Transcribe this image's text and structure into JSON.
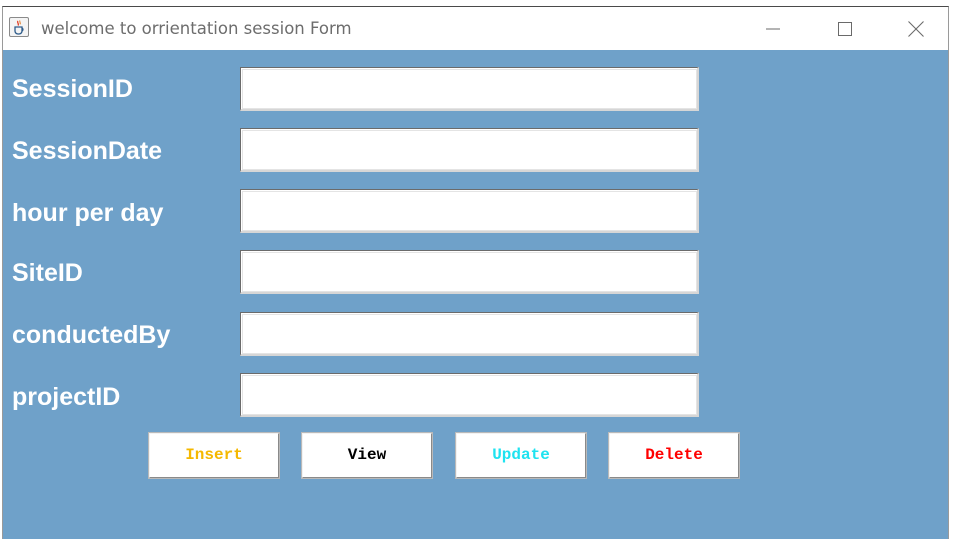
{
  "window": {
    "title": "welcome to orrientation session Form"
  },
  "form": {
    "fields": [
      {
        "label": "SessionID",
        "value": ""
      },
      {
        "label": "SessionDate",
        "value": ""
      },
      {
        "label": "hour per day",
        "value": ""
      },
      {
        "label": "SiteID",
        "value": ""
      },
      {
        "label": "conductedBy",
        "value": ""
      },
      {
        "label": "projectID",
        "value": ""
      }
    ]
  },
  "buttons": {
    "insert": {
      "label": "Insert",
      "color": "#f5b800"
    },
    "view": {
      "label": "View",
      "color": "#000000"
    },
    "update": {
      "label": "Update",
      "color": "#1fe3f0"
    },
    "delete": {
      "label": "Delete",
      "color": "#ff0000"
    }
  },
  "colors": {
    "content_background": "#6fa1c9",
    "label_text": "#ffffff"
  },
  "icons": {
    "app": "java-cup-icon",
    "minimize": "minimize-icon",
    "maximize": "maximize-icon",
    "close": "close-icon"
  }
}
